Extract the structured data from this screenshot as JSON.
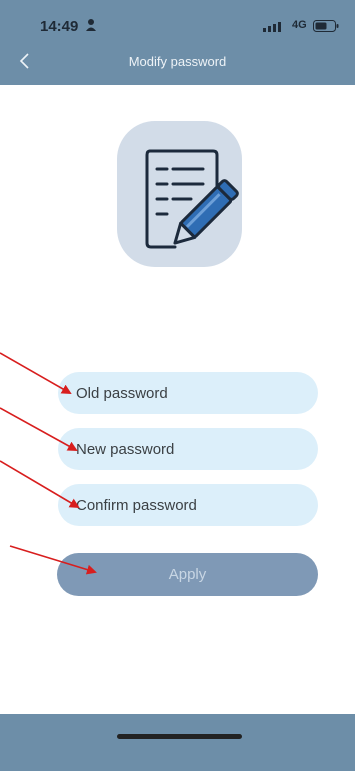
{
  "status_bar": {
    "time": "14:49",
    "network": "4G"
  },
  "header": {
    "title": "Modify password",
    "back_icon": "chevron-left-icon"
  },
  "logo": {
    "icon": "document-edit-icon"
  },
  "form": {
    "old_password_placeholder": "Old password",
    "new_password_placeholder": "New password",
    "confirm_password_placeholder": "Confirm password",
    "apply_label": "Apply"
  },
  "colors": {
    "header_bg": "#6d8ea8",
    "field_bg": "#dceffa",
    "button_bg": "#7f99b6",
    "annotation_arrow": "#d81e1e"
  }
}
